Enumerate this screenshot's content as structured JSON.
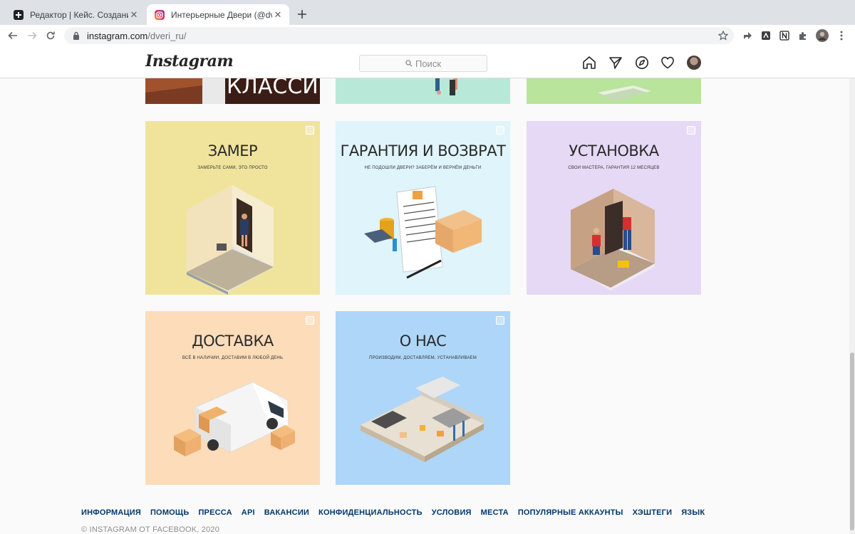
{
  "browser": {
    "tabs": [
      {
        "title": "Редактор | Кейс. Создание и",
        "active": false,
        "icon": "notion-like-plus-icon"
      },
      {
        "title": "Интерьерные Двери (@dveri_",
        "active": true,
        "icon": "instagram-icon"
      }
    ],
    "url_host": "instagram.com",
    "url_path": "/dveri_ru/"
  },
  "instagram": {
    "logo": "Instagram",
    "search_placeholder": "Поиск"
  },
  "posts_partial": [
    {
      "label": "КЛАССИК",
      "bg": "#5a2e22"
    },
    {
      "label": "",
      "bg": "#b8e9d8"
    },
    {
      "label": "",
      "bg": "#b9e49b"
    }
  ],
  "posts": [
    {
      "title": "ЗАМЕР",
      "subtitle": "ЗАМЕРЬТЕ САМИ, ЭТО ПРОСТО",
      "bg": "#f0e49d"
    },
    {
      "title": "ГАРАНТИЯ И ВОЗВРАТ",
      "subtitle": "НЕ ПОДОШЛИ ДВЕРИ? ЗАБЕРЁМ И ВЕРНЁМ ДЕНЬГИ",
      "bg": "#dff4fb"
    },
    {
      "title": "УСТАНОВКА",
      "subtitle": "СВОИ МАСТЕРА, ГАРАНТИЯ 12 МЕСЯЦЕВ",
      "bg": "#e5d9f5"
    },
    {
      "title": "ДОСТАВКА",
      "subtitle": "ВСЁ В НАЛИЧИИ, ДОСТАВИМ В ЛЮБОЙ ДЕНЬ",
      "bg": "#fddcb9"
    },
    {
      "title": "О НАС",
      "subtitle": "ПРОИЗВОДИМ, ДОСТАВЛЯЕМ, УСТАНАВЛИВАЕМ",
      "bg": "#aed6f9"
    }
  ],
  "footer": {
    "links": [
      "ИНФОРМАЦИЯ",
      "ПОМОЩЬ",
      "ПРЕССА",
      "API",
      "ВАКАНСИИ",
      "КОНФИДЕНЦИАЛЬНОСТЬ",
      "УСЛОВИЯ",
      "МЕСТА",
      "ПОПУЛЯРНЫЕ АККАУНТЫ",
      "ХЭШТЕГИ",
      "ЯЗЫК"
    ],
    "copyright": "© INSTAGRAM ОТ FACEBOOK, 2020"
  }
}
